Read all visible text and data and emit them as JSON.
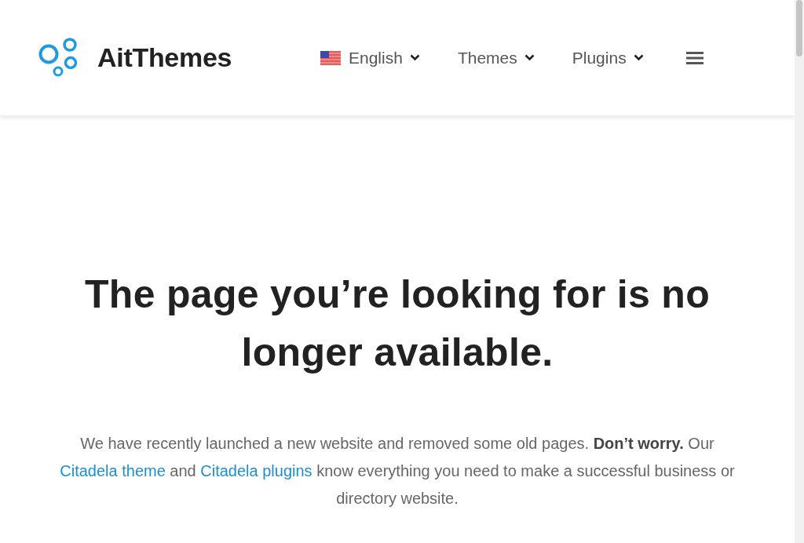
{
  "header": {
    "logo": {
      "text": "AitThemes"
    },
    "nav": [
      {
        "kind": "language",
        "label": "English"
      },
      {
        "kind": "dropdown",
        "label": "Themes"
      },
      {
        "kind": "dropdown",
        "label": "Plugins"
      }
    ]
  },
  "heading": "The page you’re looking for is no longer available.",
  "message": [
    {
      "kind": "text",
      "text": "We have recently launched a new website and removed some old pages. **Don’t worry.** Our "
    },
    {
      "kind": "link",
      "text": "Citadela theme"
    },
    {
      "kind": "text",
      "text": " and "
    },
    {
      "kind": "link",
      "text": "Citadela plugins"
    },
    {
      "kind": "text",
      "text": " know everything you need to make a successful business or directory website."
    }
  ]
}
